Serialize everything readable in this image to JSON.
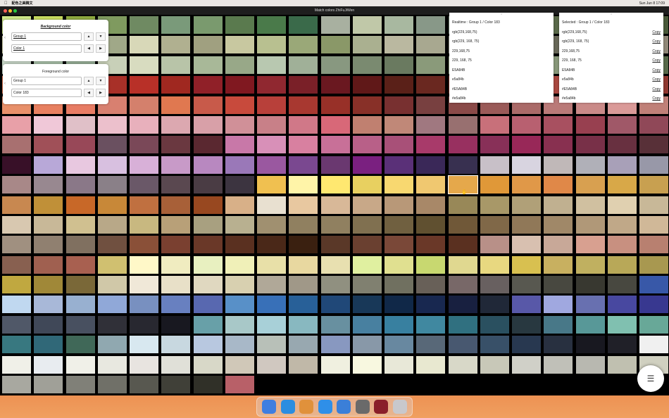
{
  "menubar": {
    "app_name": "配色之美韓文",
    "status": "Sun Jun 8  17:09"
  },
  "window": {
    "title": "Match colors ZhiFuJiWen"
  },
  "background_panel": {
    "title": "Background color",
    "group_value": "Group 1",
    "color_value": "Color 1"
  },
  "foreground_panel": {
    "title": "Foreground color",
    "group_value": "Group 1",
    "color_value": "Color 183"
  },
  "realtime_panel": {
    "heading": "Realtime : Group 1 / Color 183",
    "items": [
      "rgb(229,168,75)",
      "rgb(229, 168, 75)",
      "229,168,75",
      "229, 168, 75",
      "E5A84B",
      "e5a84b",
      "#E5A84B",
      "#e5a84b"
    ]
  },
  "selected_panel": {
    "heading": "Selected : Group 1 / Color 183",
    "items": [
      "rgb(229,168,75)",
      "rgb(229, 168, 75)",
      "229,168,75",
      "229, 168, 75",
      "E5A84B",
      "e5a84b",
      "#E5A84B",
      "#e5a84b"
    ],
    "copy_label": "Copy"
  },
  "fab": {
    "icon": "hamburger-icon",
    "glyph": "☰"
  },
  "dock": {
    "apps": [
      {
        "name": "finder-icon",
        "color": "#3f7ee0"
      },
      {
        "name": "safari-icon",
        "color": "#2b8de0"
      },
      {
        "name": "launchpad-icon",
        "color": "#e0913b"
      },
      {
        "name": "app-store-icon",
        "color": "#2f8fe8"
      },
      {
        "name": "xcode-icon",
        "color": "#3b7fd8"
      },
      {
        "name": "system-settings-icon",
        "color": "#6a6a6a"
      },
      {
        "name": "palette-app-icon",
        "color": "#8a1f2a"
      },
      {
        "name": "trash-icon",
        "color": "#c8c8cc"
      }
    ]
  },
  "swatches": [
    "#cfe88a",
    "#c8dc60",
    "#8faa40",
    "#7f9a5f",
    "#6f8a62",
    "#7a9a7a",
    "#7a9a6e",
    "#5a7a4e",
    "#4a7a4a",
    "#3a6a4a",
    "#a8b0a0",
    "#c0c8a8",
    "#a8b8a0",
    "#889888",
    "#788878",
    "#687868",
    "#7a8a6a",
    "#5a6a4a",
    "#6a7a5a",
    "#5a6a4a",
    "#4a5a3a",
    "#d8d8b0",
    "#a8ac8c",
    "#b8bc9c",
    "#a0a888",
    "#d8d8b8",
    "#b0b090",
    "#a0a080",
    "#c8c8a0",
    "#b8c090",
    "#9aa878",
    "#8a9868",
    "#aab090",
    "#bab8a0",
    "#a8a890",
    "#989888",
    "#888878",
    "#787868",
    "#686858",
    "#908870",
    "#a09888",
    "#908878",
    "#c8d8c8",
    "#a8c0a8",
    "#98b098",
    "#c8d0b8",
    "#d8dcc0",
    "#b8c4a8",
    "#a8b898",
    "#98a888",
    "#b8c8b0",
    "#a0b098",
    "#889880",
    "#7a8a70",
    "#6a7a60",
    "#8a9a7a",
    "#9aaa8a",
    "#aab89a",
    "#98a888",
    "#88987a",
    "#78886a",
    "#687a5a",
    "#586a4a",
    "#e87850",
    "#d0502a",
    "#c04030",
    "#a83028",
    "#b83028",
    "#a02820",
    "#902028",
    "#801820",
    "#902830",
    "#7a2028",
    "#6a1820",
    "#601818",
    "#5a2018",
    "#6a2820",
    "#7a3028",
    "#8a3830",
    "#9a4038",
    "#aa4840",
    "#ba5048",
    "#a04038",
    "#903830",
    "#e8906a",
    "#e88060",
    "#e87c64",
    "#d88070",
    "#d4806c",
    "#e07850",
    "#c85a4a",
    "#c84a3c",
    "#b8403a",
    "#a83830",
    "#983028",
    "#883028",
    "#783030",
    "#784040",
    "#8a4a48",
    "#9a5a58",
    "#aa6a68",
    "#ba7a78",
    "#ca8a88",
    "#da9a98",
    "#c08078",
    "#e8a0a8",
    "#f0c8d8",
    "#e0c0c8",
    "#ecc0cc",
    "#e8b0bc",
    "#dca8b0",
    "#d8a0a8",
    "#d09098",
    "#c88088",
    "#d07888",
    "#d86878",
    "#c08070",
    "#c08878",
    "#a07880",
    "#987070",
    "#c8707a",
    "#b86070",
    "#a85060",
    "#984050",
    "#a05868",
    "#904858",
    "#a87070",
    "#a05058",
    "#984858",
    "#6a5060",
    "#7a4858",
    "#6a3840",
    "#5a2830",
    "#c878a8",
    "#d890b8",
    "#d880a0",
    "#c87098",
    "#b86088",
    "#a85078",
    "#a83a6a",
    "#983060",
    "#883058",
    "#982858",
    "#883050",
    "#783048",
    "#683040",
    "#583038",
    "#381028",
    "#b8a8d8",
    "#e8c8e0",
    "#d8c0e0",
    "#d8b0d8",
    "#c89ac8",
    "#b888c0",
    "#9a78b8",
    "#9a58a0",
    "#7a4890",
    "#6a3870",
    "#7a2080",
    "#5a3078",
    "#3a2858",
    "#383050",
    "#c8c0c8",
    "#d8d4e0",
    "#c0b8b8",
    "#b0b0b8",
    "#a8a0b8",
    "#9898a8",
    "#a88888",
    "#988890",
    "#8a7888",
    "#8a8088",
    "#6a5868",
    "#5a4850",
    "#4a3c44",
    "#3c3440",
    "#f0c050",
    "#fff4a8",
    "#ffe870",
    "#e8d060",
    "#f8d870",
    "#f0c870",
    "#e5a84b",
    "#e09838",
    "#e09848",
    "#e08848",
    "#d8a050",
    "#d8a848",
    "#c8a050",
    "#c88850",
    "#c09038",
    "#c86828",
    "#c88838",
    "#c07040",
    "#a86038",
    "#984820",
    "#d8b088",
    "#e8e0d0",
    "#e8c8a0",
    "#d8b898",
    "#c8a888",
    "#b89878",
    "#a88868",
    "#988858",
    "#a89868",
    "#b0a078",
    "#c0b090",
    "#d0c0a0",
    "#e0d0b0",
    "#c8b898",
    "#d8c8b0",
    "#c8b898",
    "#d0c090",
    "#b8a888",
    "#c8b880",
    "#b8a078",
    "#a8a080",
    "#b8b090",
    "#a09070",
    "#908060",
    "#908060",
    "#807050",
    "#706040",
    "#605030",
    "#705838",
    "#806848",
    "#907858",
    "#a08868",
    "#b09878",
    "#c0a888",
    "#d0b898",
    "#a09080",
    "#908070",
    "#807060",
    "#705040",
    "#8a5038",
    "#7a4030",
    "#6a3828",
    "#5a3020",
    "#4a2818",
    "#3a2010",
    "#5a3828",
    "#6a4030",
    "#7a4838",
    "#6a3828",
    "#5a3020",
    "#b89088",
    "#d8c0b0",
    "#c8a898",
    "#d8a090",
    "#c89080",
    "#b88070",
    "#886050",
    "#a06050",
    "#a86050",
    "#d0c070",
    "#fff8c8",
    "#f0ecc0",
    "#e8f0c0",
    "#f0f0b8",
    "#e8e0a8",
    "#e8d8a0",
    "#e8e0b0",
    "#e0f0a0",
    "#e0e090",
    "#c8d870",
    "#e0d890",
    "#e8d880",
    "#d8c050",
    "#c8b060",
    "#c0b060",
    "#b8a858",
    "#a89850",
    "#c0a840",
    "#a08838",
    "#7a6838",
    "#d0c8a8",
    "#f0e8d8",
    "#e8e0c8",
    "#e0d8c0",
    "#d8d0b0",
    "#b0a898",
    "#a09888",
    "#909080",
    "#808070",
    "#707060",
    "#686058",
    "#786868",
    "#686060",
    "#585850",
    "#484840",
    "#383830",
    "#484840",
    "#3858a8",
    "#c0d8f0",
    "#a8b8d8",
    "#98b0d0",
    "#90a8d8",
    "#7890c0",
    "#6880c0",
    "#5868b0",
    "#5890c8",
    "#3870b8",
    "#286098",
    "#204878",
    "#183858",
    "#102848",
    "#182850",
    "#182040",
    "#202838",
    "#5858a8",
    "#a0a8e0",
    "#6870b0",
    "#4848a0",
    "#383890",
    "#505868",
    "#404858",
    "#485060",
    "#303038",
    "#282830",
    "#181820",
    "#68a0a8",
    "#a8c8c8",
    "#a8d0d8",
    "#88b8c0",
    "#6890a0",
    "#4880a0",
    "#3880a0",
    "#4088a0",
    "#307080",
    "#2a5060",
    "#283840",
    "#487888",
    "#589898",
    "#80c0b0",
    "#68a898",
    "#387880",
    "#306878",
    "#406858",
    "#90a8b0",
    "#d8e8f0",
    "#c8d8e0",
    "#b8c8e0",
    "#a8b8c8",
    "#b8c0b8",
    "#98a8b0",
    "#8898c0",
    "#8898a8",
    "#6888a0",
    "#586878",
    "#485870",
    "#385068",
    "#283850",
    "#283040",
    "#181820",
    "#202028",
    "#f0f0f0",
    "#f0f0e8",
    "#e8ecf0",
    "#f0f0e8",
    "#e8e8e0",
    "#e8e4e0",
    "#e0e0d8",
    "#d8d8c8",
    "#d0c8b8",
    "#d0c8c0",
    "#c0b8a8",
    "#f0f0e0",
    "#f8f8e0",
    "#e8e8d8",
    "#e8e8d0",
    "#d8d8c8",
    "#c8c8b8",
    "#d0d0c8",
    "#c0c0b8",
    "#b8b8b0",
    "#c0c0b0",
    "#d0d0c0",
    "#a8a8a0",
    "#a0a098",
    "#808078",
    "#707068",
    "#585850",
    "#404038",
    "#303028",
    "#b86068"
  ]
}
